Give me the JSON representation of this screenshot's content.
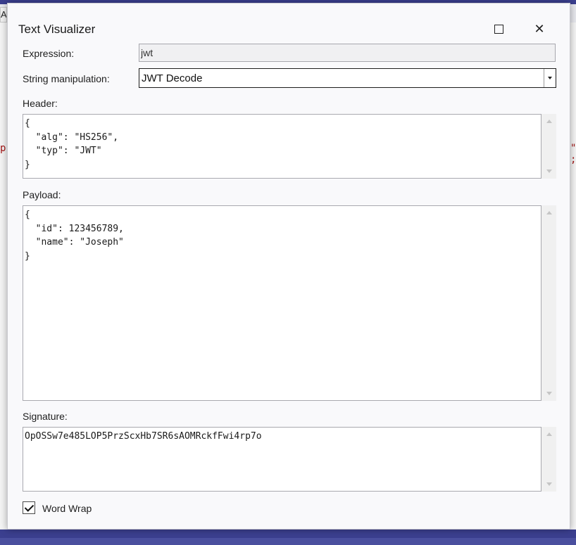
{
  "background": {
    "tab_fragment": "A",
    "left_code_fragment": "p",
    "right_code_fragment": "\" ;",
    "accent_color": "#3b3f8f"
  },
  "dialog": {
    "title": "Text Visualizer",
    "buttons": {
      "maximize_icon": "maximize-icon",
      "close_icon": "close-icon",
      "close_glyph": "✕"
    }
  },
  "expression": {
    "label": "Expression:",
    "value": "jwt"
  },
  "string_manipulation": {
    "label": "String manipulation:",
    "selected": "JWT Decode"
  },
  "header": {
    "label": "Header:",
    "content": "{\n  \"alg\": \"HS256\",\n  \"typ\": \"JWT\"\n}"
  },
  "payload": {
    "label": "Payload:",
    "content": "{\n  \"id\": 123456789,\n  \"name\": \"Joseph\"\n}"
  },
  "signature": {
    "label": "Signature:",
    "content": "OpOSSw7e485LOP5PrzScxHb7SR6sAOMRckfFwi4rp7o"
  },
  "word_wrap": {
    "label": "Word Wrap",
    "checked": true
  }
}
